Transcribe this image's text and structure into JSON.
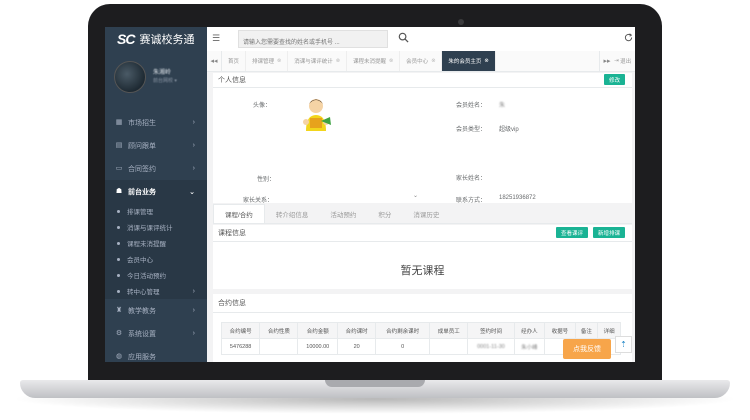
{
  "brand": {
    "logo": "SC",
    "name": "赛诚校务通"
  },
  "profile": {
    "name": "朱湘岭",
    "role": "前台网校 ▾"
  },
  "nav": [
    {
      "label": "市场招生",
      "icon": "grid-icon"
    },
    {
      "label": "顾问跟单",
      "icon": "calendar-icon"
    },
    {
      "label": "合同签约",
      "icon": "card-icon"
    },
    {
      "label": "前台业务",
      "icon": "users-icon"
    },
    {
      "label": "教学教务",
      "icon": "mortarboard-icon"
    },
    {
      "label": "系统设置",
      "icon": "gears-icon"
    },
    {
      "label": "应用服务",
      "icon": "globe-icon"
    }
  ],
  "subnav": [
    "排课管理",
    "消课与课评统计",
    "课程未消提醒",
    "会员中心",
    "今日活动预约",
    "转中心管理"
  ],
  "search": {
    "placeholder": "请输入您需要查找的姓名或手机号 ..."
  },
  "tabs": [
    {
      "label": "首页"
    },
    {
      "label": "排课管理"
    },
    {
      "label": "消课与课评统计"
    },
    {
      "label": "课程未消提醒"
    },
    {
      "label": "会员中心"
    },
    {
      "label": "朱的会员主页"
    }
  ],
  "exit_label": "退出",
  "personal": {
    "title": "个人信息",
    "edit_label": "修改",
    "avatar_label": "头像：",
    "gender_label": "性别：",
    "relation_label": "家长关系：",
    "member_name_label": "会员姓名：",
    "member_name": "朱",
    "member_type_label": "会员类型：",
    "member_type": "超级vip",
    "parent_name_label": "家长姓名：",
    "contact_label": "联系方式：",
    "contact": "18251936872"
  },
  "tabs2": [
    "课程/合约",
    "转介绍信息",
    "活动预约",
    "积分",
    "消课历史"
  ],
  "course": {
    "title": "课程信息",
    "btn_view": "查看课评",
    "btn_new": "新增排课",
    "empty": "暂无课程"
  },
  "contract": {
    "title": "合约信息",
    "headers": [
      "合约编号",
      "合约性质",
      "合约金额",
      "合约课时",
      "合约剩余课时",
      "成单员工",
      "签约时间",
      "经办人",
      "收据号",
      "备注",
      "详细"
    ],
    "rows": [
      [
        "5476288",
        "",
        "10000.00",
        "20",
        "0",
        "",
        "0001-11-30",
        "朱小峰",
        "",
        "",
        ""
      ]
    ]
  },
  "feedback_label": "点我反馈",
  "backtop_label": "⇡"
}
